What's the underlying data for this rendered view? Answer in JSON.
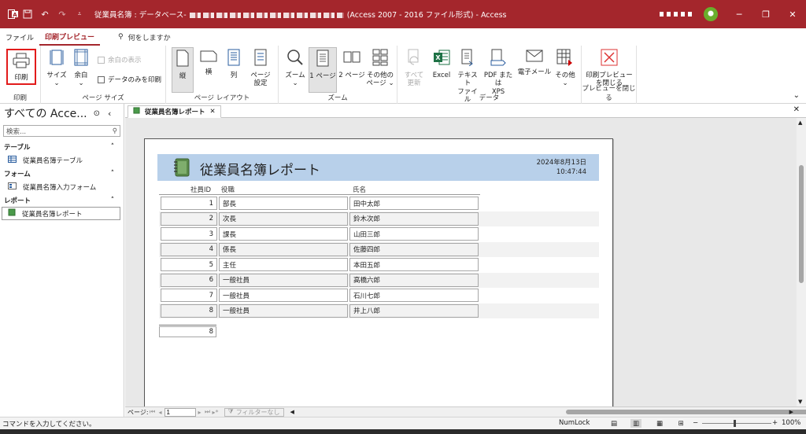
{
  "window": {
    "title_prefix": "従業員名簿 : データベース-",
    "title_suffix": "(Access 2007 - 2016 ファイル形式)  -  Access",
    "controls": {
      "minimize": "─",
      "restore": "❐",
      "close": "✕"
    }
  },
  "menu": {
    "tabs": [
      "ファイル",
      "印刷プレビュー"
    ],
    "active_tab": "印刷プレビュー",
    "search": "何をしますか"
  },
  "ribbon": {
    "print_group": {
      "label": "印刷",
      "print": "印刷"
    },
    "page_size_group": {
      "label": "ページ サイズ",
      "size": "サイズ",
      "margins": "余白",
      "show_margins": "余白の表示",
      "data_only": "データのみを印刷"
    },
    "page_layout_group": {
      "label": "ページ レイアウト",
      "portrait": "縦",
      "landscape": "横",
      "columns": "列",
      "page_setup": [
        "ページ",
        "設定"
      ]
    },
    "zoom_group": {
      "label": "ズーム",
      "zoom": "ズーム",
      "one_page": "1 ページ",
      "two_pages": "2 ページ",
      "more_pages": [
        "その他の",
        "ページ"
      ]
    },
    "data_group": {
      "label": "データ",
      "refresh_all": [
        "すべて",
        "更新"
      ],
      "excel": "Excel",
      "text_file": [
        "テキスト",
        "ファイル"
      ],
      "pdf_xps": [
        "PDF または",
        "XPS"
      ],
      "email": "電子メール",
      "more": "その他"
    },
    "close_group": {
      "label": "プレビューを閉じる",
      "close_preview": [
        "印刷プレビュー",
        "を閉じる"
      ]
    }
  },
  "nav_pane": {
    "title": "すべての Acce...",
    "search_placeholder": "検索...",
    "categories": [
      {
        "name": "テーブル",
        "items": [
          "従業員名簿テーブル"
        ]
      },
      {
        "name": "フォーム",
        "items": [
          "従業員名簿入力フォーム"
        ]
      },
      {
        "name": "レポート",
        "items": [
          "従業員名簿レポート"
        ]
      }
    ]
  },
  "document": {
    "tab_label": "従業員名簿レポート",
    "report": {
      "title": "従業員名簿レポート",
      "date": "2024年8月13日",
      "time": "10:47:44",
      "columns": [
        "社員ID",
        "役職",
        "氏名"
      ],
      "rows": [
        {
          "id": "1",
          "role": "部長",
          "name": "田中太郎"
        },
        {
          "id": "2",
          "role": "次長",
          "name": "鈴木次郎"
        },
        {
          "id": "3",
          "role": "課長",
          "name": "山田三郎"
        },
        {
          "id": "4",
          "role": "係長",
          "name": "佐藤四郎"
        },
        {
          "id": "5",
          "role": "主任",
          "name": "本田五郎"
        },
        {
          "id": "6",
          "role": "一般社員",
          "name": "高橋六郎"
        },
        {
          "id": "7",
          "role": "一般社員",
          "name": "石川七郎"
        },
        {
          "id": "8",
          "role": "一般社員",
          "name": "井上八郎"
        }
      ],
      "count": "8"
    }
  },
  "record_nav": {
    "label": "ページ:",
    "page": "1",
    "filter": "フィルターなし"
  },
  "status_bar": {
    "message": "コマンドを入力してください。",
    "numlock": "NumLock",
    "zoom": "100%"
  },
  "colors": {
    "accent": "#a4262c",
    "report_header": "#b8d0ea"
  }
}
